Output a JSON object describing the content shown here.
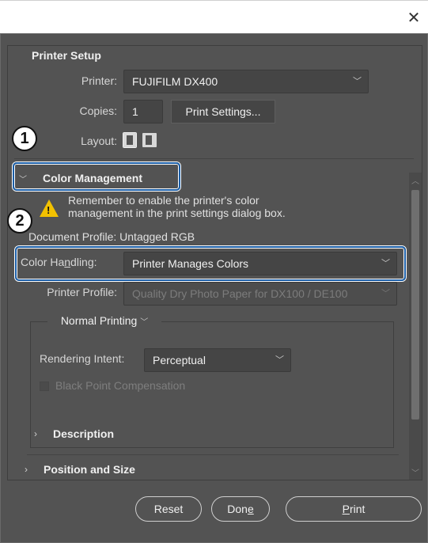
{
  "titlebar": {
    "close_icon": "close-icon"
  },
  "printer_setup": {
    "title": "Printer Setup",
    "printer_label": "Printer:",
    "printer_value": "FUJIFILM DX400",
    "copies_label": "Copies:",
    "copies_value": "1",
    "print_settings_label": "Print Settings...",
    "layout_label": "Layout:"
  },
  "color_management": {
    "title": "Color Management",
    "warning_line1": "Remember to enable the printer's color",
    "warning_line2": "management in the print settings dialog box.",
    "document_profile": "Document Profile: Untagged RGB",
    "color_handling_label_pre": "Color Ha",
    "color_handling_label_ul": "n",
    "color_handling_label_post": "dling:",
    "color_handling_value": "Printer Manages Colors",
    "printer_profile_label": "Printer Profile:",
    "printer_profile_value": "Quality Dry Photo Paper for DX100 / DE100",
    "normal_printing": "Normal Printing",
    "rendering_intent_label": "Rendering Intent:",
    "rendering_intent_value": "Perceptual",
    "black_point_label": "Black Point Compensation"
  },
  "sections": {
    "description": "Description",
    "position_and_size": "Position and Size"
  },
  "buttons": {
    "reset": "Reset",
    "done_pre": "Don",
    "done_ul": "e",
    "print_ul": "P",
    "print_post": "rint"
  },
  "callouts": {
    "one": "1",
    "two": "2"
  },
  "colors": {
    "dialog_bg": "#535353",
    "callout": "#1c5fa8",
    "warning": "#f2c100"
  }
}
